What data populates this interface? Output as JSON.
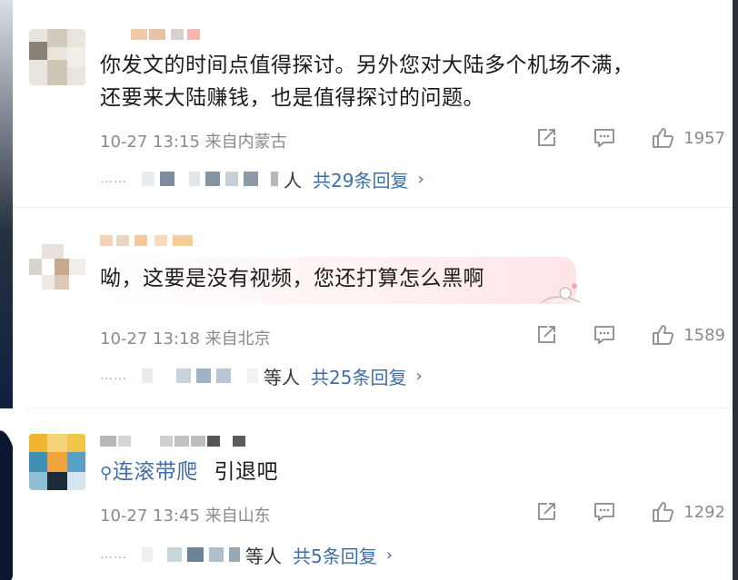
{
  "comments": [
    {
      "text_line1": "你发文的时间点值得探讨。另外您对大陆多个机场不满，",
      "text_line2": "还要来大陆赚钱，也是值得探讨的问题。",
      "time": "10-27 13:15",
      "location": "来自内蒙古",
      "likes": "1957",
      "reply_prefix": "人",
      "reply_total": "共29条回复",
      "chevron": "›"
    },
    {
      "text": "呦，这要是没有视频，您还打算怎么黑啊",
      "time": "10-27 13:18",
      "location": "来自北京",
      "likes": "1589",
      "reply_prefix": "等人",
      "reply_total": "共25条回复",
      "chevron": "›"
    },
    {
      "link_text": "连滚带爬",
      "link_icon": "search-icon",
      "text": "引退吧",
      "time": "10-27 13:45",
      "location": "来自山东",
      "likes": "1292",
      "reply_prefix": "等人",
      "reply_total": "共5条回复",
      "chevron": "›"
    }
  ],
  "dots": "……",
  "icons": {
    "share": "share-icon",
    "comment": "comment-icon",
    "like": "like-icon"
  },
  "colors": {
    "link": "#3f6fa8",
    "meta": "#8a8a8a",
    "text": "#1b1b1b"
  }
}
